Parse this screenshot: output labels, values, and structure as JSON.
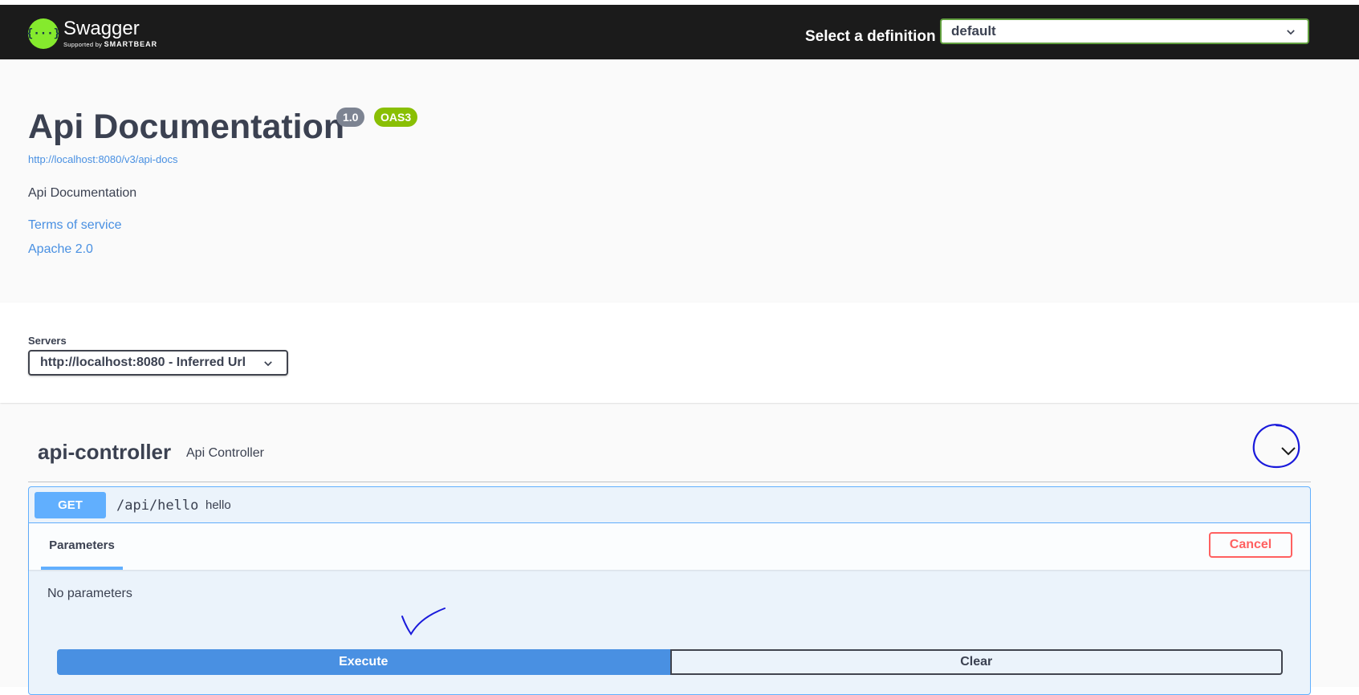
{
  "topbar": {
    "logo": {
      "name": "Swagger",
      "supported_by": "Supported by",
      "company": "SMARTBEAR",
      "symbol": "{···}"
    },
    "definition_label": "Select a definition",
    "definition_value": "default"
  },
  "info": {
    "title": "Api Documentation",
    "version_badge": "1.0",
    "oas_badge": "OAS3",
    "docs_url": "http://localhost:8080/v3/api-docs",
    "description": "Api Documentation",
    "terms_link": "Terms of service",
    "license_link": "Apache 2.0"
  },
  "servers": {
    "label": "Servers",
    "selected": "http://localhost:8080 - Inferred Url"
  },
  "tag": {
    "name": "api-controller",
    "description": "Api Controller"
  },
  "operation": {
    "method": "GET",
    "path": "/api/hello",
    "summary": "hello",
    "parameters_tab": "Parameters",
    "cancel_label": "Cancel",
    "no_params_text": "No parameters",
    "execute_label": "Execute",
    "clear_label": "Clear"
  },
  "colors": {
    "get_method": "#61affe",
    "execute": "#4990e2",
    "cancel": "#ff6060",
    "oas_badge": "#89bf04",
    "annotation_ink": "#1a1adb"
  }
}
